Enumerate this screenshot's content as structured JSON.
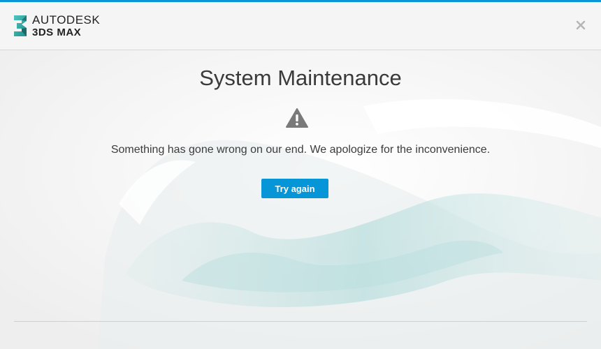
{
  "header": {
    "brand_top": "AUTODESK",
    "brand_bottom": "3DS MAX",
    "accent_color": "#0696d7",
    "logo_icon": "3ds-max-logo-icon",
    "close_icon": "close-icon"
  },
  "main": {
    "title": "System Maintenance",
    "warning_icon": "warning-icon",
    "message": "Something has gone wrong on our end. We apologize for the inconvenience.",
    "try_again_label": "Try again",
    "button_color": "#0696d7"
  }
}
